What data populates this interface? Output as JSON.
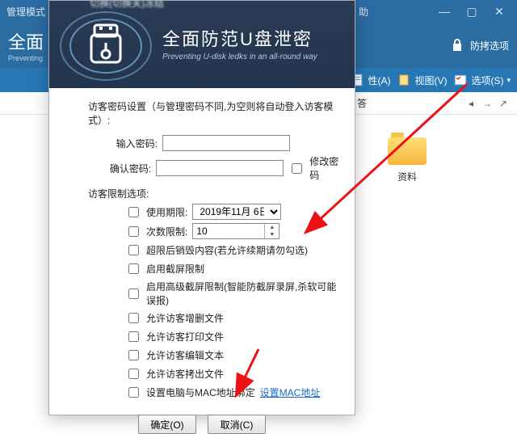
{
  "window": {
    "mode_label": "管理模式",
    "help_label": "助"
  },
  "brand": {
    "cn": "全面",
    "en": "Preventing",
    "copy_protect": "防拷选项"
  },
  "toolbar": {
    "attr": "性(A)",
    "view": "视图(V)",
    "options": "选项(S)"
  },
  "folder": {
    "name": "资料"
  },
  "dialog": {
    "title_blur": "切换(切换关)冻结",
    "banner_cn": "全面防范U盘泄密",
    "banner_en": "Preventing U-disk ledks in an all-round way",
    "section_pwd": "访客密码设置（与管理密码不同,为空则将自动登入访客模式）:",
    "pwd_label": "输入密码:",
    "pwd2_label": "确认密码:",
    "chk_change_pwd": "修改密码",
    "section_limit": "访客限制选项:",
    "use_until": "使用期限:",
    "date_value": "2019年11月 6日",
    "count_limit": "次数限制:",
    "count_value": "10",
    "over_destroy": "超限后销毁内容(若允许续期请勿勾选)",
    "cap_limit": "启用截屏限制",
    "adv_cap": "启用高级截屏限制(智能防截屏录屏,杀软可能误报)",
    "allow_add_del": "允许访客增删文件",
    "allow_print": "允许访客打印文件",
    "allow_edit": "允许访客编辑文本",
    "allow_copyout": "允许访客拷出文件",
    "mac_bind": "设置电脑与MAC地址绑定",
    "mac_link": "设置MAC地址",
    "ok": "确定(O)",
    "cancel": "取消(C)"
  }
}
